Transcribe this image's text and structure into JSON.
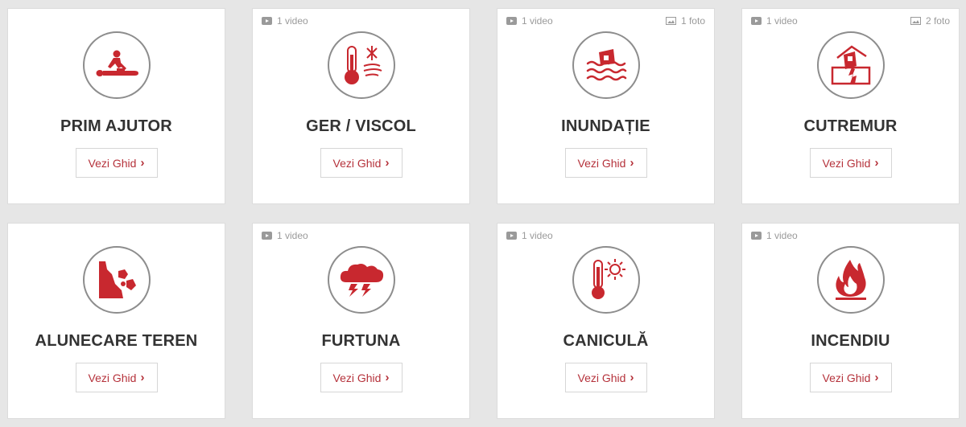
{
  "colors": {
    "accent": "#c8282f",
    "button_text": "#b5323b",
    "title": "#333333",
    "meta": "#9a9a9a",
    "background": "#e6e6e6"
  },
  "button_label": "Vezi Ghid",
  "button_chevron": "›",
  "cards": [
    {
      "title": "PRIM AJUTOR",
      "icon": "first-aid-cpr-icon",
      "video": "",
      "foto": ""
    },
    {
      "title": "GER / VISCOL",
      "icon": "frost-blizzard-icon",
      "video": "1 video",
      "foto": ""
    },
    {
      "title": "INUNDAȚIE",
      "icon": "flood-house-icon",
      "video": "1 video",
      "foto": "1 foto"
    },
    {
      "title": "CUTREMUR",
      "icon": "earthquake-house-icon",
      "video": "1 video",
      "foto": "2 foto"
    },
    {
      "title": "ALUNECARE TEREN",
      "icon": "landslide-icon",
      "video": "",
      "foto": ""
    },
    {
      "title": "FURTUNA",
      "icon": "storm-cloud-icon",
      "video": "1 video",
      "foto": ""
    },
    {
      "title": "CANICULĂ",
      "icon": "heatwave-thermometer-icon",
      "video": "1 video",
      "foto": ""
    },
    {
      "title": "INCENDIU",
      "icon": "fire-icon",
      "video": "1 video",
      "foto": ""
    }
  ]
}
